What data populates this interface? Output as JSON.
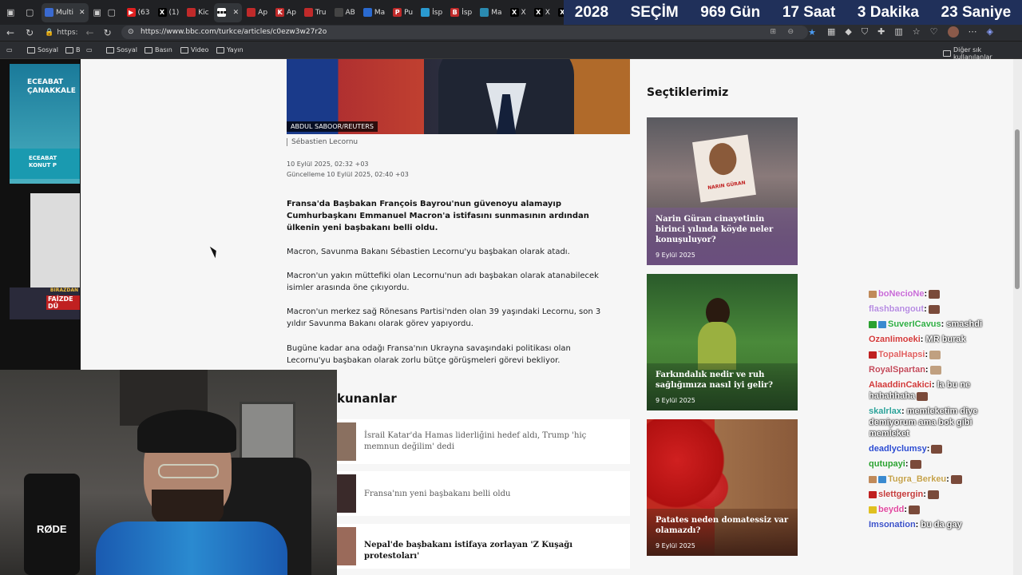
{
  "tabs": [
    {
      "label": "Multi",
      "active": true
    },
    {
      "label": "(63"
    },
    {
      "label": "(1)"
    },
    {
      "label": "Kic"
    },
    {
      "label": "",
      "active_bbc": true
    },
    {
      "label": "Ap"
    },
    {
      "label": "Ap"
    },
    {
      "label": "Tru"
    },
    {
      "label": "AB"
    },
    {
      "label": "Ma"
    },
    {
      "label": "Pu"
    },
    {
      "label": "İsp"
    },
    {
      "label": "İsp"
    },
    {
      "label": "Ma"
    },
    {
      "label": "X"
    },
    {
      "label": "X"
    },
    {
      "label": "X"
    }
  ],
  "ticker": {
    "year": "2028",
    "election": "SEÇİM",
    "days": "969 Gün",
    "hours": "17 Saat",
    "minutes": "3 Dakika",
    "seconds": "23 Saniye"
  },
  "address": {
    "back_url_fragment": "https:",
    "url": "https://www.bbc.com/turkce/articles/c0ezw3w27r2o"
  },
  "bookmarks": {
    "left": [
      "Sosyal",
      "B"
    ],
    "items": [
      "Sosyal",
      "Basın",
      "Video",
      "Yayın"
    ],
    "other": "Diğer sık kullanılanlar"
  },
  "side_thumbs": {
    "t1": "ECEABAT ÇANAKKALE",
    "t2": "ECEABAT KONUT P",
    "t3": "FAİZDE DÜ",
    "t4": "BİRAZDAN"
  },
  "article": {
    "photo_credit": "ABDUL SABOOR/REUTERS",
    "caption": "Sébastien Lecornu",
    "published": "10 Eylül 2025, 02:32 +03",
    "updated": "Güncelleme 10 Eylül 2025, 02:40 +03",
    "lead": "Fransa'da Başbakan François Bayrou'nun güvenoyu alamayıp Cumhurbaşkanı Emmanuel Macron'a istifasını sunmasının ardından ülkenin yeni başbakanı belli oldu.",
    "p1": "Macron, Savunma Bakanı Sébastien Lecornu'yu başbakan olarak atadı.",
    "p2": "Macron'un yakın müttefiki olan Lecornu'nun adı başbakan olarak atanabilecek isimler arasında öne çıkıyordu.",
    "p3": "Macron'un merkez sağ Rönesans Partisi'nden olan 39 yaşındaki Lecornu, son 3 yıldır Savunma Bakanı olarak görev yapıyordu.",
    "p4": "Bugüne kadar ana odağı Fransa'nın Ukrayna savaşındaki politikası olan Lecornu'yu başbakan olarak zorlu bütçe görüşmeleri görevi bekliyor."
  },
  "popular": {
    "title": "kunanlar",
    "items": [
      "İsrail Katar'da Hamas liderliğini hedef aldı, Trump 'hiç memnun değilim' dedi",
      "Fransa'nın yeni başbakanı belli oldu",
      "Nepal'de başbakanı istifaya zorlayan 'Z Kuşağı protestoları'"
    ]
  },
  "picks": {
    "title": "Seçtiklerimiz",
    "cards": [
      {
        "title": "Narin Güran cinayetinin birinci yılında köyde neler konuşuluyor?",
        "date": "9 Eylül 2025",
        "sign": "NARIN GÜRAN"
      },
      {
        "title": "Farkındalık nedir ve ruh sağlığımıza nasıl iyi gelir?",
        "date": "9 Eylül 2025"
      },
      {
        "title": "Patates neden domatessiz var olamazdı?",
        "date": "9 Eylül 2025"
      }
    ]
  },
  "chat": [
    {
      "user": "boNecioNe",
      "msg": "",
      "color": "#c76ad6"
    },
    {
      "user": "flashbangout",
      "msg": "",
      "color": "#b58be0"
    },
    {
      "user": "SuverICavus",
      "msg": "smashdi",
      "color": "#2fae44"
    },
    {
      "user": "OzanIimoeki",
      "msg": "MR burak",
      "color": "#d33a3a"
    },
    {
      "user": "TopalHapsi",
      "msg": "",
      "color": "#e06060"
    },
    {
      "user": "RoyalSpartan",
      "msg": "",
      "color": "#c24a5a"
    },
    {
      "user": "AlaaddinCakici",
      "msg": "la bu ne hahahhaha",
      "color": "#d03838"
    },
    {
      "user": "skalrlax",
      "msg": "memleketim diye demiyorum ama bok gibi memleket",
      "color": "#2aa198"
    },
    {
      "user": "deadlyclumsy",
      "msg": "",
      "color": "#2a4ad0"
    },
    {
      "user": "qutupayi",
      "msg": "",
      "color": "#2aa130"
    },
    {
      "user": "Tugra_Berkeu",
      "msg": "",
      "color": "#c4a14a"
    },
    {
      "user": "slettgergin",
      "msg": "",
      "color": "#c43a3a"
    },
    {
      "user": "beydd",
      "msg": "",
      "color": "#e04aa0"
    },
    {
      "user": "Imsonation",
      "msg": "bu da gay",
      "color": "#3a50c8"
    }
  ],
  "webcam": {
    "mic_brand": "RØDE"
  }
}
